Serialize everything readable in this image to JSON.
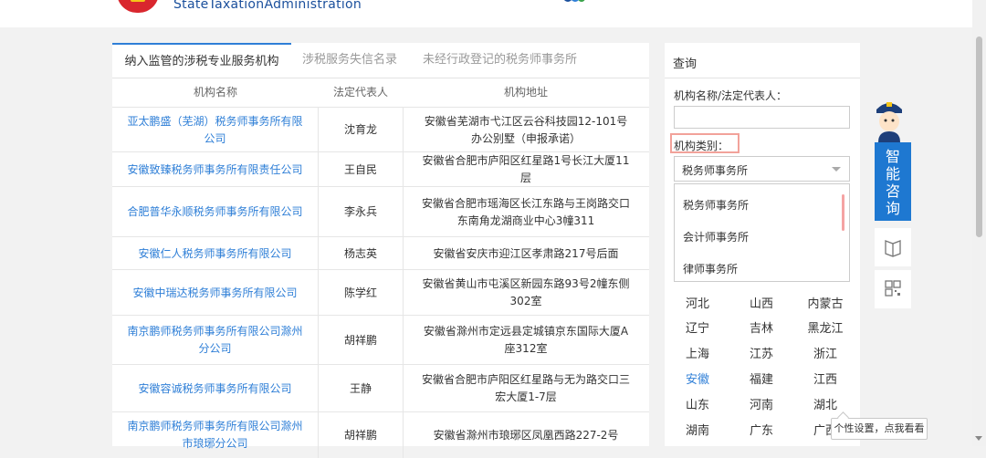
{
  "header": {
    "site_name_en": "StateTaxationAdministration"
  },
  "tabs": [
    {
      "label": "纳入监管的涉税专业服务机构",
      "active": true
    },
    {
      "label": "涉税服务失信名录",
      "active": false
    },
    {
      "label": "未经行政登记的税务师事务所",
      "active": false
    }
  ],
  "table": {
    "headers": [
      "机构名称",
      "法定代表人",
      "机构地址"
    ],
    "rows": [
      {
        "name": "亚太鹏盛（芜湖）税务师事务所有限公司",
        "rep": "沈育龙",
        "addr": "安徽省芜湖市弋江区云谷科技园12-101号办公别墅（申报承诺）"
      },
      {
        "name": "安徽致臻税务师事务所有限责任公司",
        "rep": "王自民",
        "addr": "安徽省合肥市庐阳区红星路1号长江大厦11层"
      },
      {
        "name": "合肥普华永顺税务师事务所有限公司",
        "rep": "李永兵",
        "addr": "安徽省合肥市瑶海区长江东路与王岗路交口东南角龙湖商业中心3幢311"
      },
      {
        "name": "安徽仁人税务师事务所有限公司",
        "rep": "杨志英",
        "addr": "安徽省安庆市迎江区孝肃路217号后面"
      },
      {
        "name": "安徽中瑞达税务师事务所有限公司",
        "rep": "陈学红",
        "addr": "安徽省黄山市屯溪区新园东路93号2幢东侧302室"
      },
      {
        "name": "南京鹏师税务师事务所有限公司滁州分公司",
        "rep": "胡祥鹏",
        "addr": "安徽省滁州市定远县定城镇京东国际大厦A座312室"
      },
      {
        "name": "安徽容诚税务师事务所有限公司",
        "rep": "王静",
        "addr": "安徽省合肥市庐阳区红星路与无为路交口三宏大厦1-7层"
      },
      {
        "name": "南京鹏师税务师事务所有限公司滁州市琅琊分公司",
        "rep": "胡祥鹏",
        "addr": "安徽省滁州市琅琊区凤凰西路227-2号"
      }
    ]
  },
  "query": {
    "title": "查询",
    "name_label": "机构名称/法定代表人：",
    "name_value": "",
    "type_label": "机构类别：",
    "type_selected": "税务师事务所",
    "type_options": [
      "税务师事务所",
      "会计师事务所",
      "律师事务所"
    ],
    "provinces": [
      [
        "河北",
        "山西",
        "内蒙古"
      ],
      [
        "辽宁",
        "吉林",
        "黑龙江"
      ],
      [
        "上海",
        "江苏",
        "浙江"
      ],
      [
        "安徽",
        "福建",
        "江西"
      ],
      [
        "山东",
        "河南",
        "湖北"
      ],
      [
        "湖南",
        "广东",
        "广西"
      ]
    ],
    "active_province": "安徽"
  },
  "consult": {
    "label_chars": [
      "智",
      "能",
      "咨",
      "询"
    ],
    "tooltip": "个性设置，点我看看"
  },
  "colors": {
    "accent": "#2f7fd7",
    "consult_bg": "#1e78d1",
    "highlight_border": "#f2a29a"
  }
}
